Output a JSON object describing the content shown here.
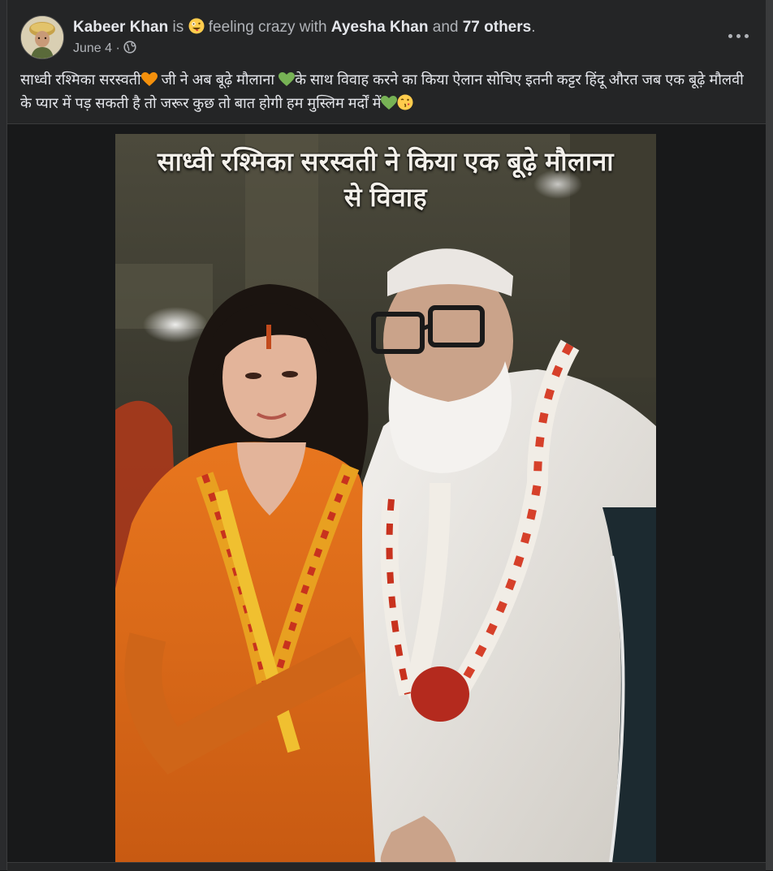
{
  "post": {
    "author": "Kabeer Khan",
    "activity_is": "is",
    "feeling_emoji": "crazy-face-emoji",
    "activity_feeling": "feeling crazy with",
    "tagged_person": "Ayesha Khan",
    "and_text": "and",
    "others_count_label": "77 others",
    "period": ".",
    "date": "June 4",
    "dot_separator": "·",
    "privacy_icon": "globe-icon",
    "more_icon": "ellipsis-icon",
    "caption_part1": "साध्वी रश्मिका सरस्वती",
    "caption_heart1": "orange-heart-emoji",
    "caption_part2": " जी ने अब बूढ़े मौलाना ",
    "caption_heart2": "green-heart-emoji",
    "caption_part3": "के साथ विवाह करने का किया ऐलान सोचिए इतनी कट्टर हिंदू औरत जब एक बूढ़े मौलवी के प्यार में पड़ सकती है तो जरूर कुछ तो बात होगी हम मुस्लिम मर्दों में",
    "caption_heart3": "green-heart-emoji",
    "caption_kiss": "face-blowing-kiss-emoji"
  },
  "photo": {
    "overlay_line1": "साध्वी रश्मिका सरस्वती ने किया एक बूढ़े मौलाना",
    "overlay_line2": "से विवाह"
  },
  "colors": {
    "background": "#18191a",
    "card": "#242526",
    "primary_text": "#e4e6eb",
    "secondary_text": "#b0b3b8",
    "orange_heart": "#f4900c",
    "green_heart": "#77b255"
  }
}
